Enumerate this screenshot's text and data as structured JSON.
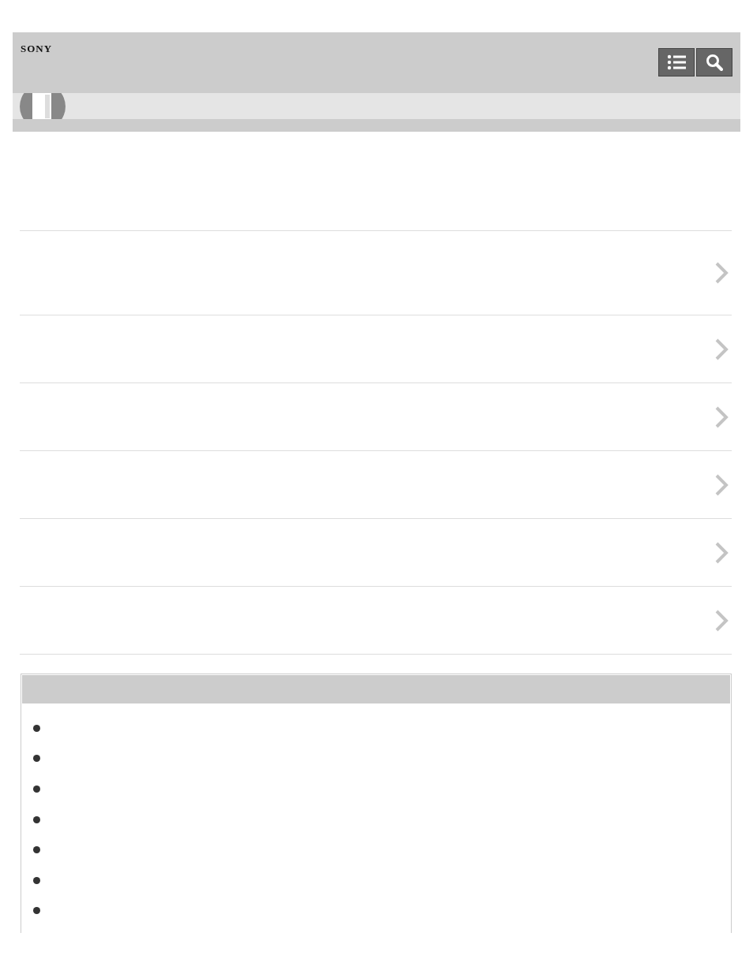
{
  "header": {
    "logo": "SONY"
  },
  "nav_rows": [
    {
      "kind": "link"
    },
    {
      "kind": "link"
    },
    {
      "kind": "link"
    },
    {
      "kind": "link"
    },
    {
      "kind": "link"
    },
    {
      "kind": "link"
    }
  ],
  "related_box": {
    "items": [
      {
        "kind": "bullet"
      },
      {
        "kind": "bullet"
      },
      {
        "kind": "bullet"
      },
      {
        "kind": "bullet"
      },
      {
        "kind": "bullet"
      },
      {
        "kind": "bullet"
      },
      {
        "kind": "bullet"
      }
    ]
  }
}
